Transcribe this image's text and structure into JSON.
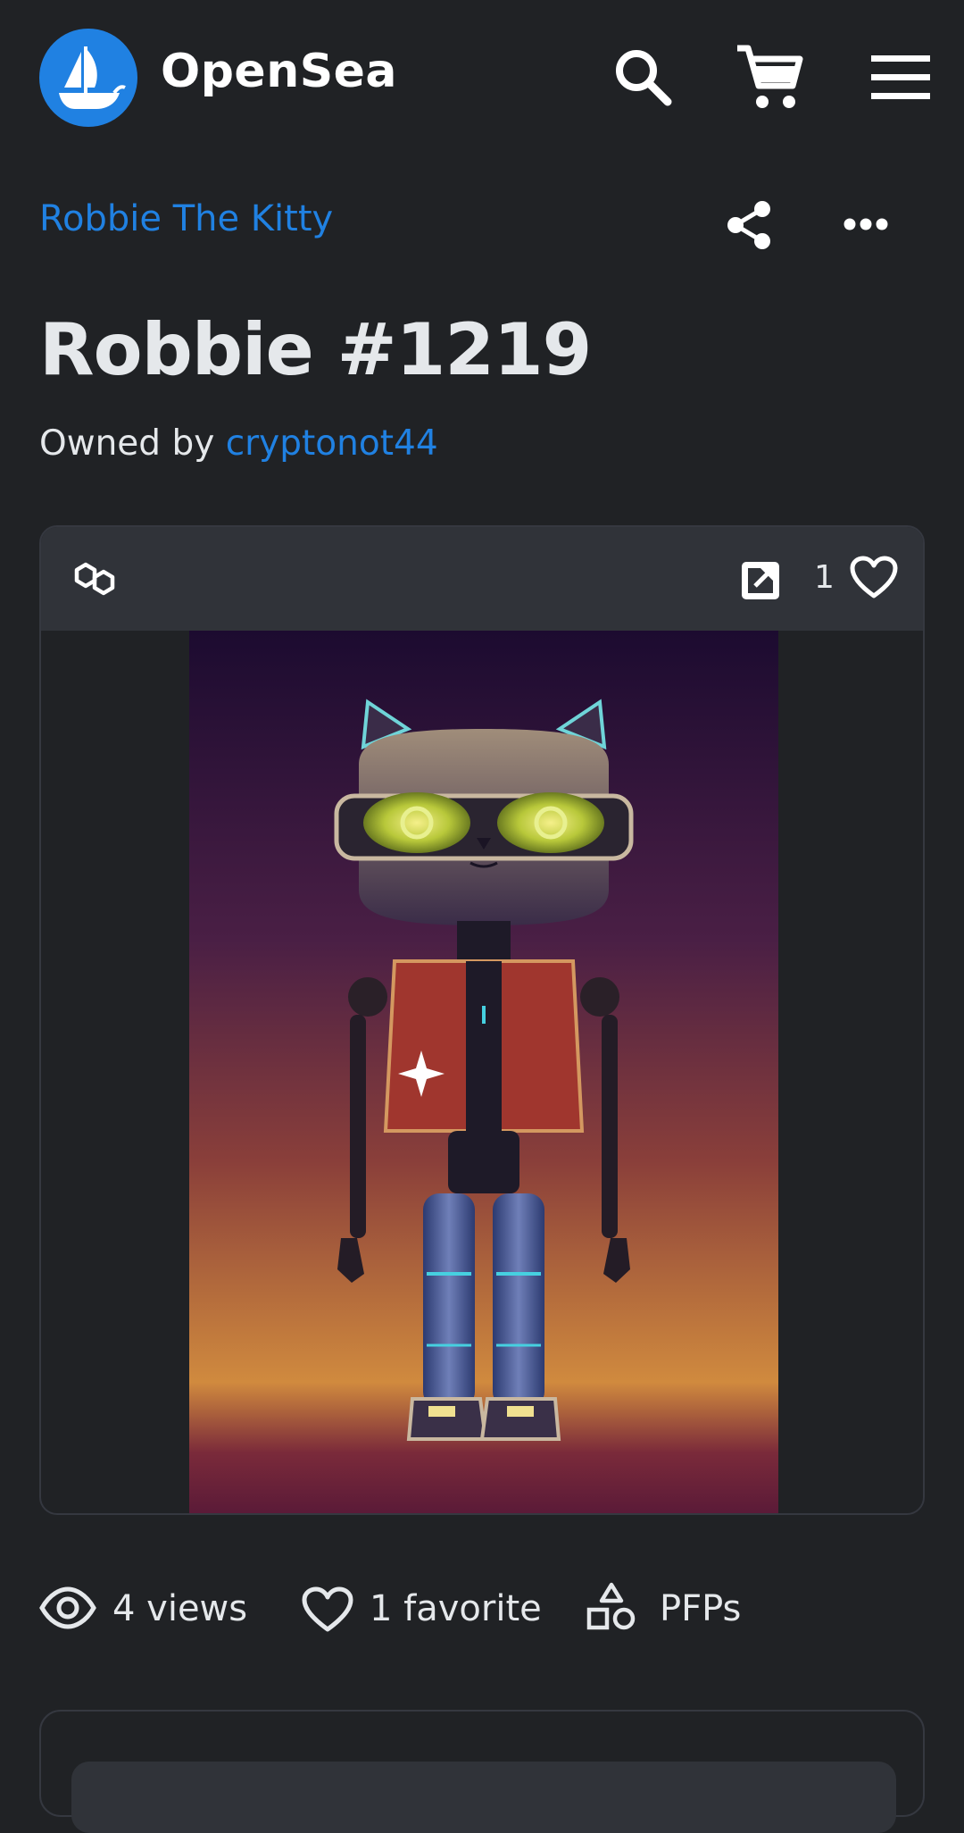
{
  "header": {
    "brand": "OpenSea",
    "icons": [
      "opensea-logo-icon",
      "search-icon",
      "cart-icon",
      "menu-icon"
    ]
  },
  "item": {
    "collection": "Robbie The Kitty",
    "title": "Robbie #1219",
    "owned_by_label": "Owned by ",
    "owner": "cryptonot44",
    "actions": [
      "share-icon",
      "more-icon"
    ]
  },
  "media": {
    "chain_icon": "polygon-chain-icon",
    "favorites_count": "1",
    "artwork_alt": "robot-cat-artwork"
  },
  "stats": {
    "views": "4 views",
    "favorites": "1 favorite",
    "category": "PFPs"
  },
  "colors": {
    "background": "#202225",
    "card_bar": "#303339",
    "accent": "#2081e2",
    "text": "#e5e8eb"
  }
}
